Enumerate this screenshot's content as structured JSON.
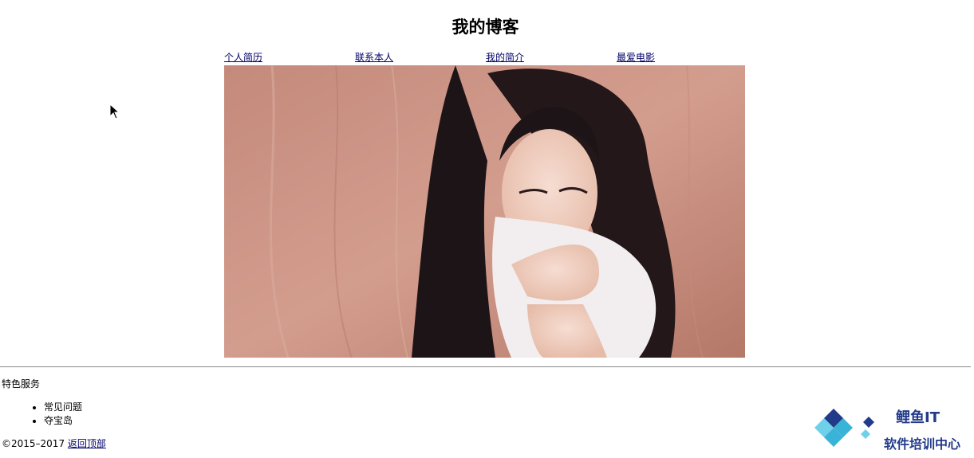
{
  "header": {
    "title": "我的博客"
  },
  "nav": {
    "items": [
      {
        "label": "个人简历"
      },
      {
        "label": "联系本人"
      },
      {
        "label": "我的简介"
      },
      {
        "label": "最爱电影"
      }
    ]
  },
  "hero": {
    "image": "portrait-photo"
  },
  "services": {
    "title": "特色服务",
    "items": [
      "常见问题",
      "夺宝岛"
    ]
  },
  "footer": {
    "copyright": "©2015–2017",
    "back_to_top": "返回顶部"
  },
  "logo": {
    "line1": "鲤鱼IT",
    "line2": "软件培训中心",
    "colors": {
      "primary": "#223a8a",
      "secondary": "#3ab3d8"
    }
  }
}
